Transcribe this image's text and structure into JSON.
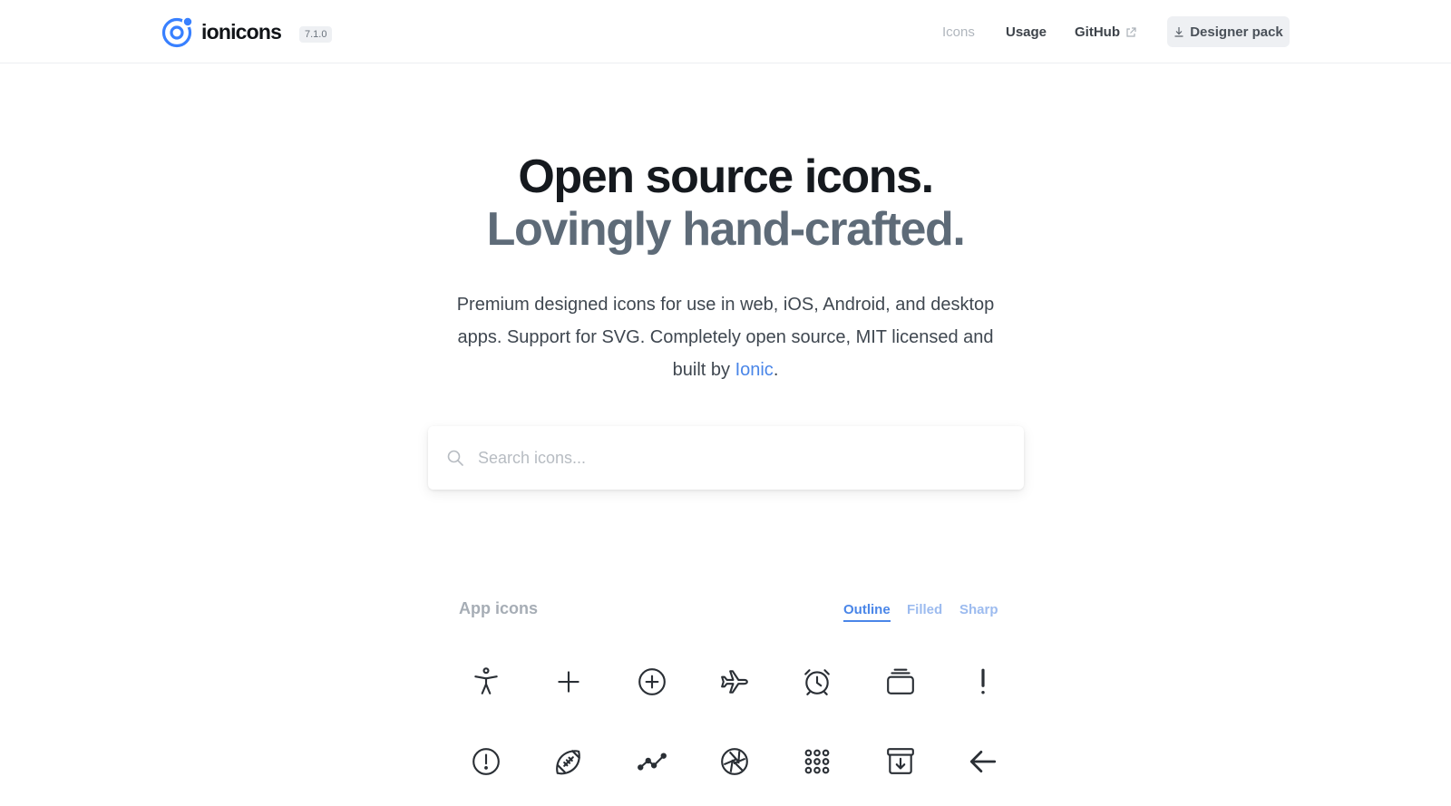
{
  "header": {
    "logo_text": "ionicons",
    "version": "7.1.0",
    "nav": {
      "icons": "Icons",
      "usage": "Usage",
      "github": "GitHub"
    },
    "designer_pack": "Designer pack",
    "brand_color": "#3880ff"
  },
  "hero": {
    "title_line1": "Open source icons.",
    "title_line2": "Lovingly hand-crafted.",
    "desc_prefix": "Premium designed icons for use in web, iOS, Android, and desktop apps. Support for SVG. Completely open source, MIT licensed and built by ",
    "desc_link": "Ionic",
    "desc_suffix": "."
  },
  "search": {
    "placeholder": "Search icons..."
  },
  "section": {
    "title": "App icons",
    "tabs": [
      {
        "label": "Outline",
        "active": true
      },
      {
        "label": "Filled",
        "active": false
      },
      {
        "label": "Sharp",
        "active": false
      }
    ]
  },
  "icons": {
    "row1": [
      "accessibility-icon",
      "add-icon",
      "add-circle-icon",
      "airplane-icon",
      "alarm-icon",
      "albums-icon",
      "alert-icon"
    ],
    "row2": [
      "alert-circle-icon",
      "american-football-icon",
      "analytics-icon",
      "aperture-icon",
      "apps-icon",
      "archive-icon",
      "arrow-back-icon"
    ]
  }
}
